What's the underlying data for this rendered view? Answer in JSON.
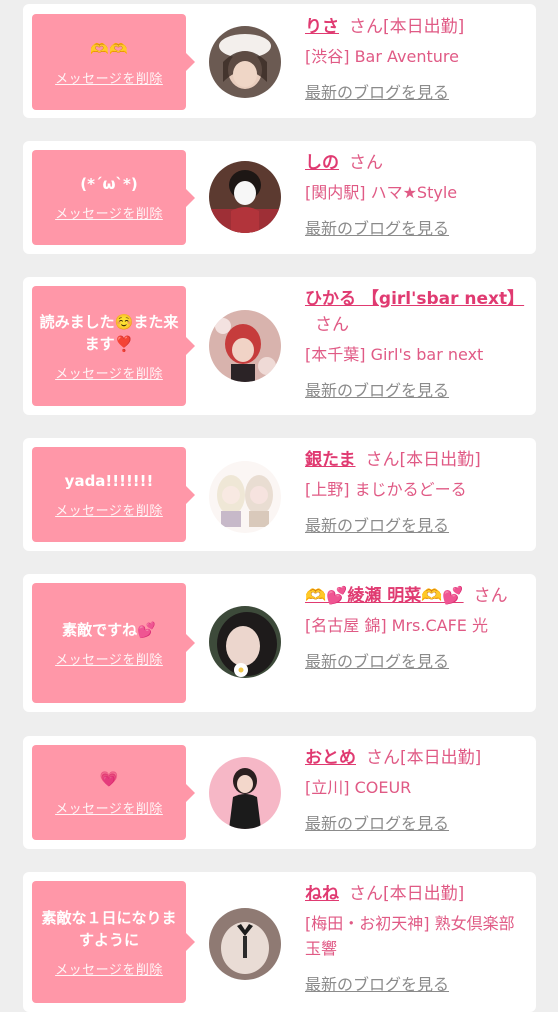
{
  "delete_label": "メッセージを削除",
  "san_label": "さん",
  "blog_label": "最新のブログを見る",
  "colors": {
    "bubble": "#ff97a8",
    "name": "#e03a71",
    "shop": "#e05a85",
    "blog": "#8b8b8b",
    "background": "#eeeeee"
  },
  "items": [
    {
      "message": "🫶🫶",
      "name": "りさ",
      "status": "[本日出勤]",
      "shop": "[渋谷] Bar Aventure"
    },
    {
      "message": "(*´ω`*)",
      "name": "しの",
      "status": "",
      "shop": "[関内駅] ハマ★Style"
    },
    {
      "message": "読みました☺️また来ます❣️",
      "name": "ひかる 【girl'sbar next】",
      "status": "",
      "shop": "[本千葉] Girl's bar next"
    },
    {
      "message": "yada!!!!!!!",
      "name": "銀たま",
      "status": "[本日出勤]",
      "shop": "[上野] まじかるどーる"
    },
    {
      "message": "素敵ですね💕",
      "name": "🫶💕綾瀬 明菜🫶💕",
      "status": "",
      "shop": "[名古屋 錦] Mrs.CAFE 光"
    },
    {
      "message": "💗",
      "name": "おとめ",
      "status": "[本日出勤]",
      "shop": "[立川] COEUR"
    },
    {
      "message": "素敵な１日になりますように",
      "name": "ねね",
      "status": "[本日出勤]",
      "shop": "[梅田・お初天神] 熟女倶楽部 玉響"
    }
  ]
}
